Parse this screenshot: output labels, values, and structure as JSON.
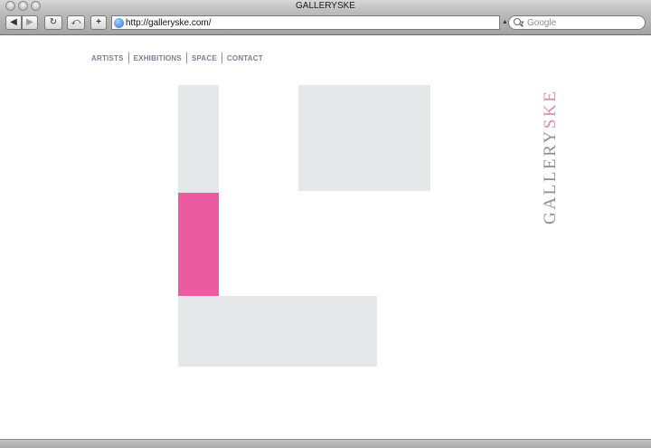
{
  "window": {
    "title": "GALLERYSKE"
  },
  "toolbar": {
    "back_icon": "◀",
    "forward_icon": "▶",
    "reload_icon": "↻",
    "snapback_icon": "⤺",
    "add_icon": "+"
  },
  "address": {
    "url": "http://galleryske.com/"
  },
  "search": {
    "placeholder": "Google"
  },
  "nav": {
    "items": [
      {
        "label": "ARTISTS"
      },
      {
        "label": "EXHIBITIONS"
      },
      {
        "label": "SPACE"
      },
      {
        "label": "CONTACT"
      }
    ]
  },
  "logo": {
    "part1": "GALLERY",
    "part2": "SKE"
  },
  "colors": {
    "accent_pink": "#ea5ba0",
    "block_gray": "#e6e7e9",
    "nav_text": "#7a7e98",
    "logo_gray": "#8e8e8e",
    "logo_pink": "#d78fb0"
  }
}
